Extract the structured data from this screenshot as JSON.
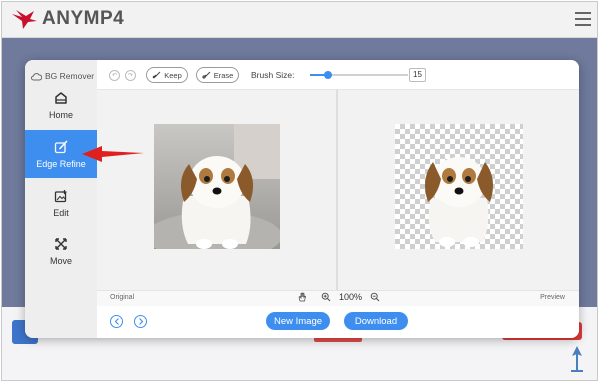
{
  "site": {
    "brand": "ANYMP4",
    "menu_icon": "hamburger-menu-icon"
  },
  "app": {
    "title": "BG Remover",
    "nav": [
      {
        "label": "Home",
        "icon": "home-icon",
        "active": false
      },
      {
        "label": "Edge Refine",
        "icon": "edge-refine-icon",
        "active": true
      },
      {
        "label": "Edit",
        "icon": "image-edit-icon",
        "active": false
      },
      {
        "label": "Move",
        "icon": "move-icon",
        "active": false
      }
    ]
  },
  "toolbar": {
    "undo_icon": "undo-icon",
    "redo_icon": "redo-icon",
    "keep_label": "Keep",
    "erase_label": "Erase",
    "brush_label": "Brush Size:",
    "brush_value": "15",
    "brush_level_fraction": 0.18
  },
  "canvas": {
    "original_label": "Original",
    "preview_label": "Preview",
    "zoom": "100%"
  },
  "footer": {
    "new_image_label": "New Image",
    "download_label": "Download"
  },
  "colors": {
    "accent": "#3e8ef0",
    "callout_arrow": "#e01f1f",
    "brand_red": "#c8102e"
  }
}
